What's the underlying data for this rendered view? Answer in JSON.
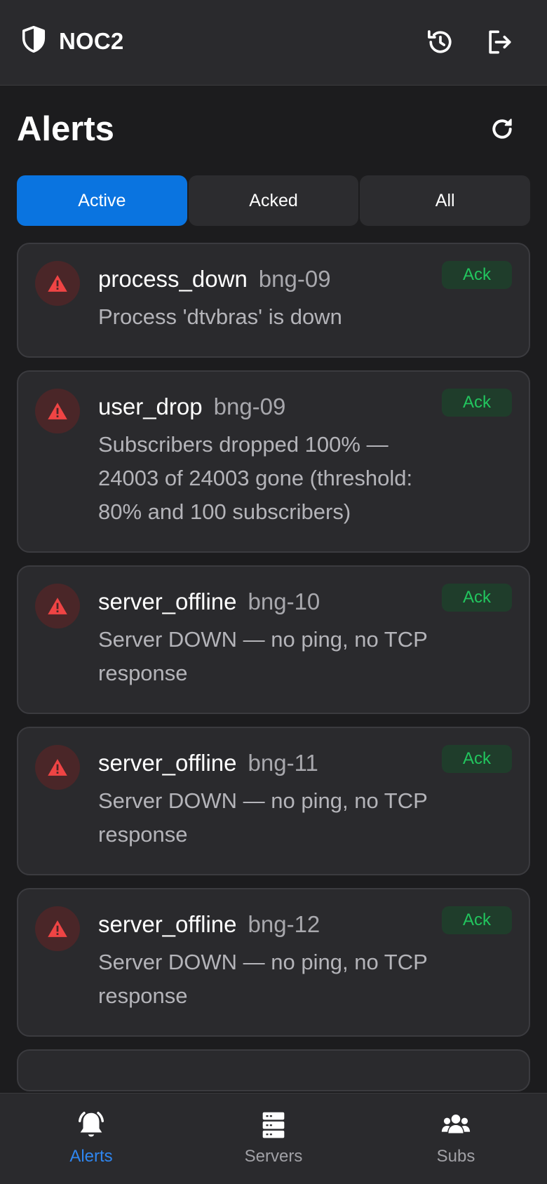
{
  "header": {
    "brand": "NOC2",
    "icons": {
      "brand": "shield-icon",
      "history": "history-icon",
      "logout": "logout-icon"
    }
  },
  "page": {
    "title": "Alerts",
    "refresh_icon": "refresh-icon"
  },
  "tabs": [
    {
      "label": "Active",
      "active": true
    },
    {
      "label": "Acked",
      "active": false
    },
    {
      "label": "All",
      "active": false
    }
  ],
  "alerts": [
    {
      "type": "process_down",
      "host": "bng-09",
      "message": "Process 'dtvbras' is down",
      "action": "Ack",
      "severity_icon": "warning-triangle-icon"
    },
    {
      "type": "user_drop",
      "host": "bng-09",
      "message": "Subscribers dropped 100% — 24003 of 24003 gone (threshold: 80% and 100 subscribers)",
      "action": "Ack",
      "severity_icon": "warning-triangle-icon"
    },
    {
      "type": "server_offline",
      "host": "bng-10",
      "message": "Server DOWN — no ping, no TCP response",
      "action": "Ack",
      "severity_icon": "warning-triangle-icon"
    },
    {
      "type": "server_offline",
      "host": "bng-11",
      "message": "Server DOWN — no ping, no TCP response",
      "action": "Ack",
      "severity_icon": "warning-triangle-icon"
    },
    {
      "type": "server_offline",
      "host": "bng-12",
      "message": "Server DOWN — no ping, no TCP response",
      "action": "Ack",
      "severity_icon": "warning-triangle-icon"
    }
  ],
  "bottom_nav": [
    {
      "label": "Alerts",
      "icon": "bell-icon",
      "active": true
    },
    {
      "label": "Servers",
      "icon": "servers-icon",
      "active": false
    },
    {
      "label": "Subs",
      "icon": "users-icon",
      "active": false
    }
  ],
  "colors": {
    "background": "#1c1c1e",
    "surface": "#2a2a2d",
    "accent": "#0a74e0",
    "danger": "#ef4444",
    "success": "#22c55e"
  }
}
